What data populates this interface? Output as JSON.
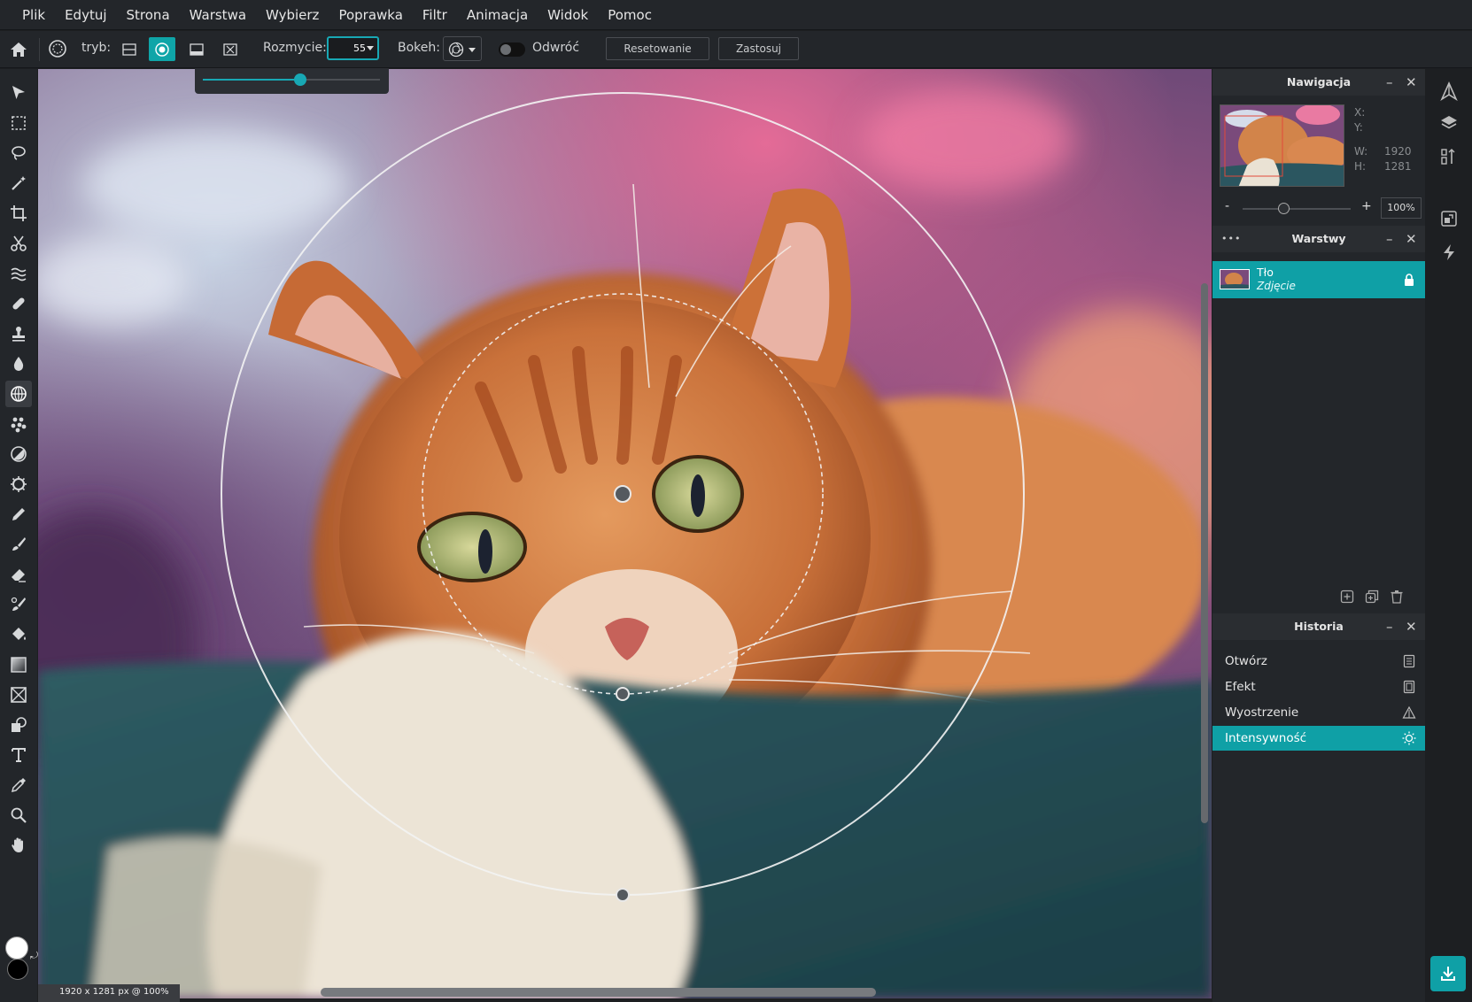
{
  "menu": [
    "Plik",
    "Edytuj",
    "Strona",
    "Warstwa",
    "Wybierz",
    "Poprawka",
    "Filtr",
    "Animacja",
    "Widok",
    "Pomoc"
  ],
  "options": {
    "mode_label": "tryb:",
    "blur_label": "Rozmycie:",
    "blur_value": "55",
    "blur_slider_fraction": 0.55,
    "bokeh_label": "Bokeh:",
    "invert_label": "Odwróć",
    "invert_on": false,
    "reset_label": "Resetowanie",
    "apply_label": "Zastosuj",
    "active_mode": "radial"
  },
  "tools": [
    "move-icon",
    "marquee-icon",
    "lasso-icon",
    "magic-wand-icon",
    "crop-icon",
    "cut-icon",
    "liquify-icon",
    "healing-icon",
    "stamp-icon",
    "blur-drop-icon",
    "focus-blur-icon",
    "clone-dots-icon",
    "dodge-icon",
    "sponge-icon",
    "pencil-icon",
    "brush-icon",
    "eraser-icon",
    "color-replace-icon",
    "fill-bucket-icon",
    "gradient-icon",
    "frame-icon",
    "shape-icon",
    "text-icon",
    "eyedropper-icon",
    "zoom-icon",
    "hand-icon"
  ],
  "colors": {
    "foreground": "#ffffff",
    "background": "#000000",
    "accent": "#0fa0a6"
  },
  "status": "1920 x 1281 px @ 100%",
  "navigation": {
    "title": "Nawigacja",
    "x_label": "X:",
    "y_label": "Y:",
    "w_label": "W:",
    "w_value": "1920",
    "h_label": "H:",
    "h_value": "1281",
    "zoom_minus": "-",
    "zoom_plus": "+",
    "zoom_value": "100%"
  },
  "layers": {
    "title": "Warstwy",
    "menu_dots": "•••",
    "items": [
      {
        "name": "Tło",
        "type": "Zdjęcie",
        "locked": true
      }
    ]
  },
  "history": {
    "title": "Historia",
    "items": [
      {
        "label": "Otwórz",
        "icon": "document-icon"
      },
      {
        "label": "Efekt",
        "icon": "document-icon"
      },
      {
        "label": "Wyostrzenie",
        "icon": "triangle-icon"
      },
      {
        "label": "Intensywność",
        "icon": "sun-icon",
        "active": true
      }
    ]
  },
  "panel_controls": {
    "minimize": "–",
    "close": "✕"
  }
}
